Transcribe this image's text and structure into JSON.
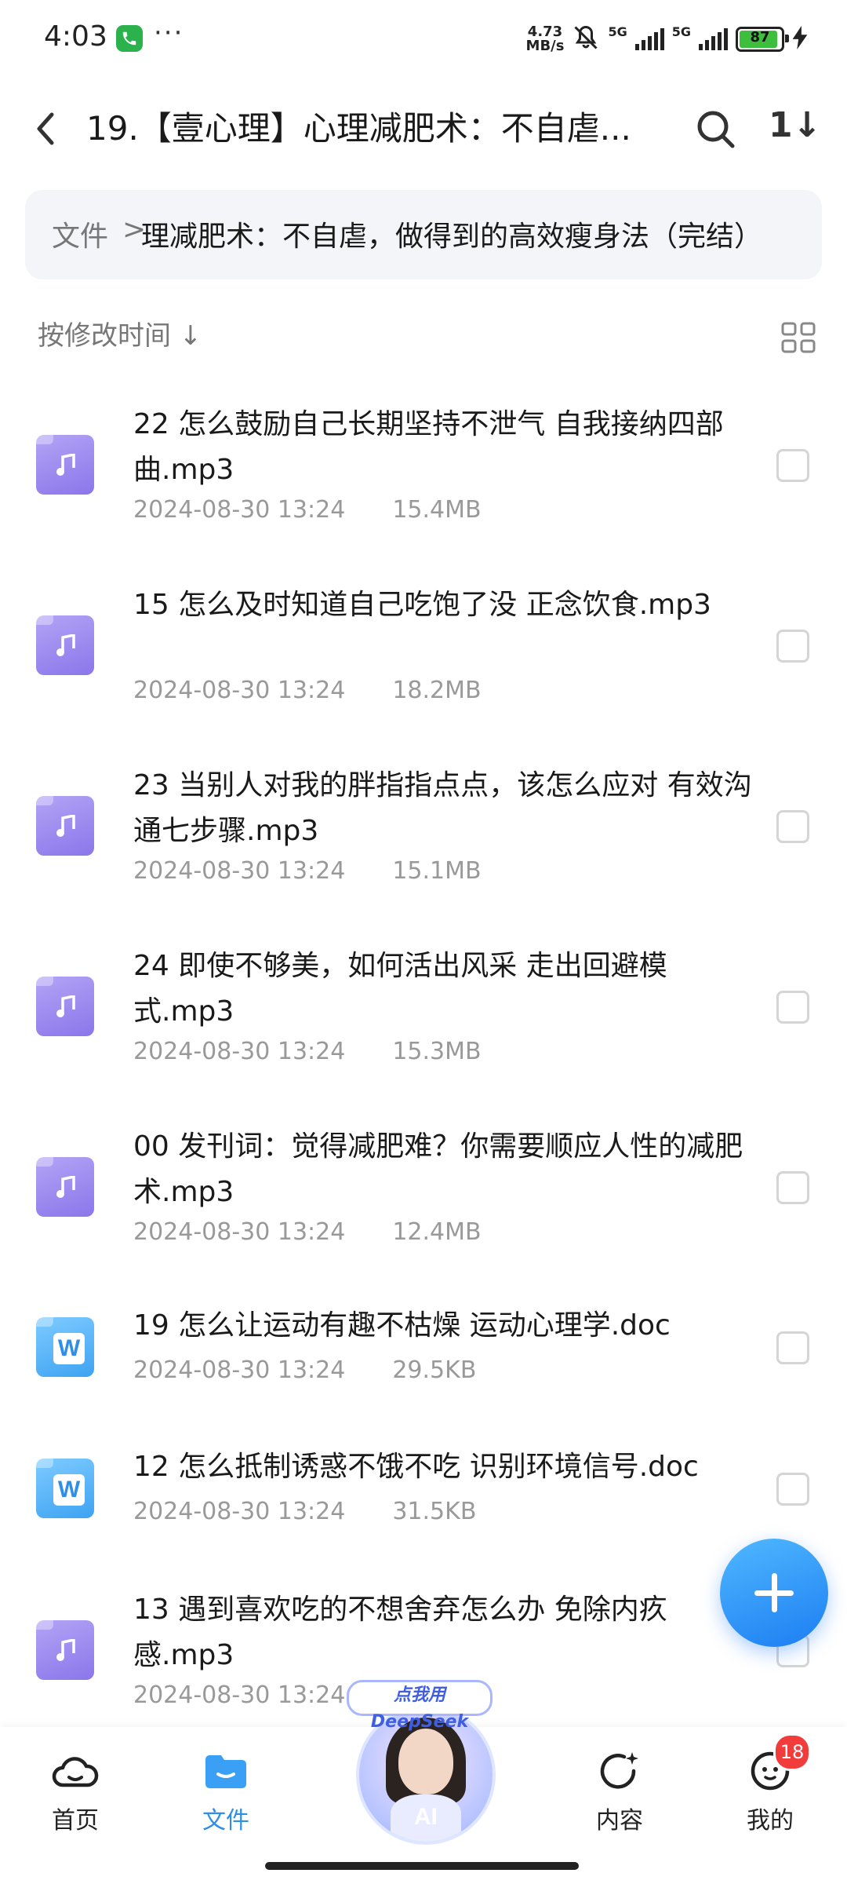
{
  "status_bar": {
    "time": "4:03",
    "more": "···",
    "speed_value": "4.73",
    "speed_unit": "MB/s",
    "net1": "5G",
    "net2": "5G",
    "battery": "87"
  },
  "header": {
    "title": "19.【壹心理】心理减肥术：不自虐...",
    "back_icon": "chevron-left-icon",
    "search_icon": "search-icon",
    "sort_label": "1↓"
  },
  "breadcrumb": {
    "root": "文件",
    "separator": ">",
    "current": "理减肥术：不自虐，做得到的高效瘦身法（完结）"
  },
  "sort": {
    "label": "按修改时间 ↓",
    "view_icon": "grid-view-icon"
  },
  "files": [
    {
      "name": "22 怎么鼓励自己长期坚持不泄气  自我接纳四部曲.mp3",
      "date": "2024-08-30 13:24",
      "size": "15.4MB",
      "type": "mp3"
    },
    {
      "name": "15 怎么及时知道自己吃饱了没  正念饮食.mp3",
      "date": "2024-08-30 13:24",
      "size": "18.2MB",
      "type": "mp3"
    },
    {
      "name": "23 当别人对我的胖指指点点，该怎么应对  有效沟通七步骤.mp3",
      "date": "2024-08-30 13:24",
      "size": "15.1MB",
      "type": "mp3"
    },
    {
      "name": "24 即使不够美，如何活出风采  走出回避模式.mp3",
      "date": "2024-08-30 13:24",
      "size": "15.3MB",
      "type": "mp3"
    },
    {
      "name": "00 发刊词：觉得减肥难？你需要顺应人性的减肥术.mp3",
      "date": "2024-08-30 13:24",
      "size": "12.4MB",
      "type": "mp3"
    },
    {
      "name": "19 怎么让运动有趣不枯燥  运动心理学.doc",
      "date": "2024-08-30 13:24",
      "size": "29.5KB",
      "type": "doc"
    },
    {
      "name": "12 怎么抵制诱惑不饿不吃  识别环境信号.doc",
      "date": "2024-08-30 13:24",
      "size": "31.5KB",
      "type": "doc"
    },
    {
      "name": "13 遇到喜欢吃的不想舍弃怎么办  免除内疚感.mp3",
      "date": "2024-08-30 13:24",
      "size": "",
      "type": "mp3"
    }
  ],
  "doc_letter": "W",
  "fab_icon": "plus-icon",
  "ai": {
    "badge": "点我用DeepSeek",
    "label": "AI"
  },
  "nav": {
    "home": "首页",
    "files": "文件",
    "content": "内容",
    "mine": "我的",
    "badge_count": "18"
  },
  "colors": {
    "accent": "#2f8fe8",
    "mp3_icon": "#9b87ef",
    "doc_icon": "#55b4fb",
    "badge": "#f23b3b"
  }
}
